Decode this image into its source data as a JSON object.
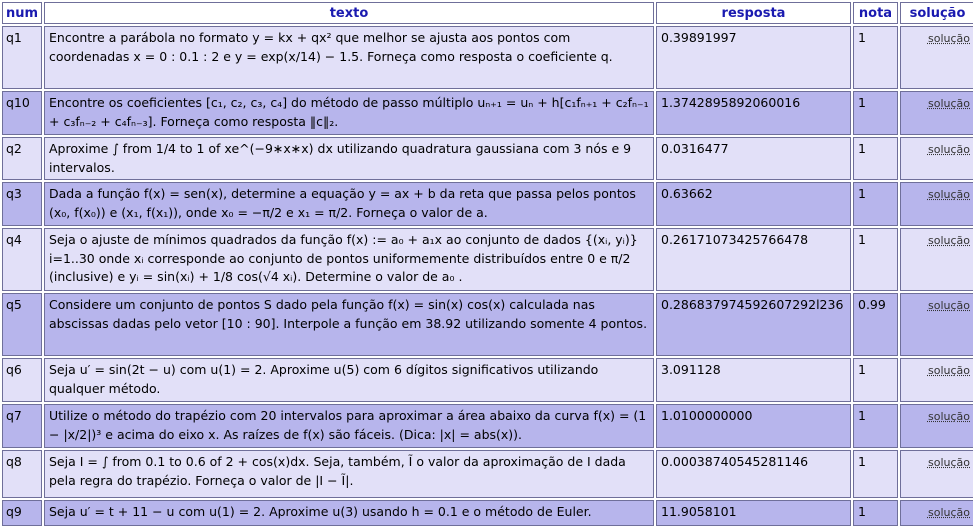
{
  "headers": {
    "num": "num",
    "texto": "texto",
    "resposta": "resposta",
    "nota": "nota",
    "solucao": "solução"
  },
  "rows": [
    {
      "num": "q1",
      "texto": "Encontre a parábola no formato y = kx + qx² que melhor se ajusta aos pontos com coordenadas x = 0 : 0.1 : 2 e y = exp(x/14) − 1.5. Forneça como resposta o coeficiente q.",
      "resposta": "0.39891997",
      "nota": "1",
      "solucao": "solução"
    },
    {
      "num": "q10",
      "texto": "Encontre os coeficientes [c₁, c₂, c₃, c₄] do método de passo múltiplo uₙ₊₁ = uₙ + h[c₁fₙ₊₁ + c₂fₙ₋₁ + c₃fₙ₋₂ + c₄fₙ₋₃]. Forneça como resposta ‖c‖₂.",
      "resposta": "1.3742895892060016",
      "nota": "1",
      "solucao": "solução"
    },
    {
      "num": "q2",
      "texto": "Aproxime ∫ from 1/4 to 1 of xe^(−9∗x∗x) dx utilizando quadratura gaussiana com 3 nós e 9 intervalos.",
      "resposta": "0.0316477",
      "nota": "1",
      "solucao": "solução"
    },
    {
      "num": "q3",
      "texto": "Dada a função f(x) = sen(x), determine a equação y = ax + b da reta que passa pelos pontos (x₀, f(x₀)) e (x₁, f(x₁)), onde x₀ = −π/2 e x₁ = π/2. Forneça o valor de a.",
      "resposta": "0.63662",
      "nota": "1",
      "solucao": "solução"
    },
    {
      "num": "q4",
      "texto": "Seja o ajuste de mínimos quadrados da função f(x) := a₀ + a₁x ao conjunto de dados {(xᵢ, yᵢ)} i=1..30 onde xᵢ corresponde ao conjunto de pontos uniformemente distribuídos entre 0 e π/2 (inclusive) e yᵢ = sin(xᵢ) + 1/8 cos(√4 xᵢ). Determine o valor de a₀ .",
      "resposta": "0.26171073425766478",
      "nota": "1",
      "solucao": "solução"
    },
    {
      "num": "q5",
      "texto": "Considere um conjunto de pontos S dado pela função f(x) = sin(x) cos(x) calculada nas abscissas dadas pelo vetor [10 : 90]. Interpole a função em 38.92 utilizando somente 4 pontos.",
      "resposta": "0.286837974592607292l236",
      "nota": "0.99",
      "solucao": "solução"
    },
    {
      "num": "q6",
      "texto": "Seja u′ = sin(2t − u) com u(1) = 2. Aproxime u(5) com 6 dígitos significativos utilizando qualquer método.",
      "resposta": "3.091128",
      "nota": "1",
      "solucao": "solução"
    },
    {
      "num": "q7",
      "texto": "Utilize o método do trapézio com 20 intervalos para aproximar a área abaixo da curva f(x) = (1 − |x/2|)³ e acima do eixo x. As raízes de f(x) são fáceis. (Dica: |x| = abs(x)).",
      "resposta": "1.0100000000",
      "nota": "1",
      "solucao": "solução"
    },
    {
      "num": "q8",
      "texto": "Seja I = ∫ from 0.1 to 0.6 of 2 + cos(x)dx. Seja, também, Ĩ o valor da aproximação de I dada pela regra do trapézio. Forneça o valor de |I − Ĩ|.",
      "resposta": "0.00038740545281146",
      "nota": "1",
      "solucao": "solução"
    },
    {
      "num": "q9",
      "texto": "Seja u′ = t + 11 − u com u(1) = 2. Aproxime u(3) usando h = 0.1 e o método de Euler.",
      "resposta": "11.9058101",
      "nota": "1",
      "solucao": "solução"
    }
  ]
}
